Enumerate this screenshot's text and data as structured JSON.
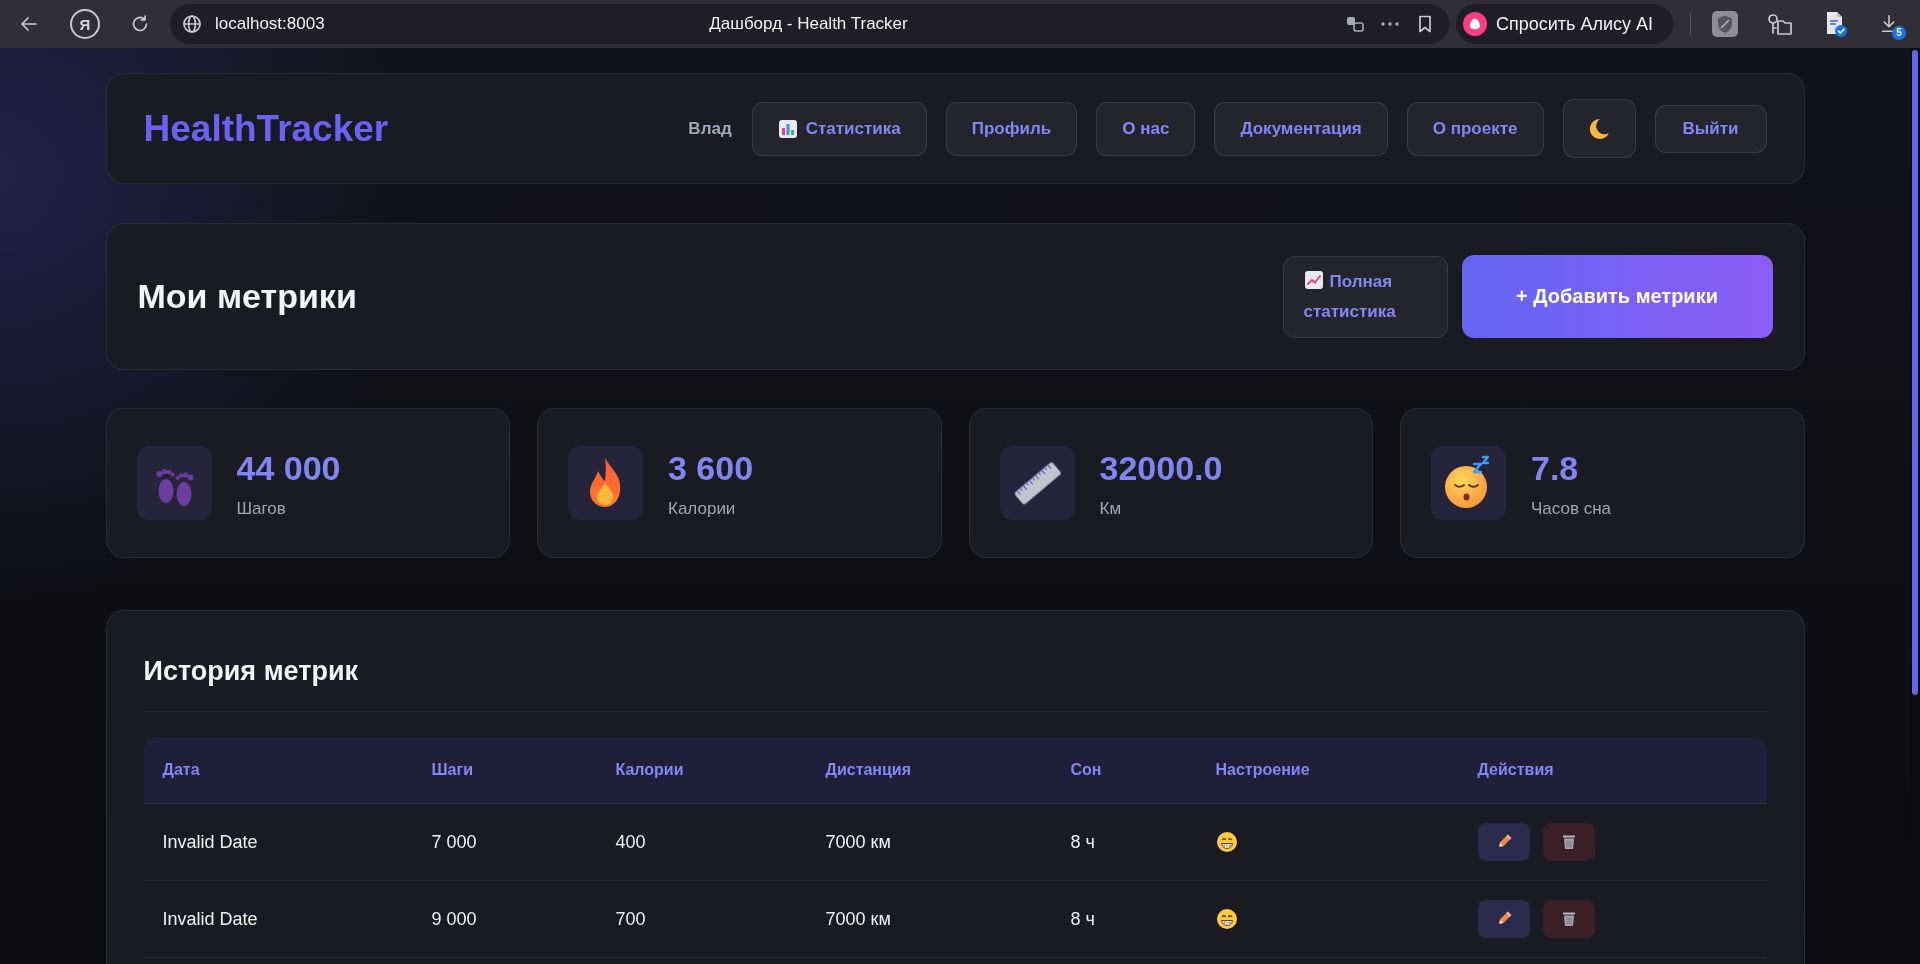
{
  "browser": {
    "home_button": "Я",
    "address": "localhost:8003",
    "page_title": "Дашборд - Health Tracker",
    "assistant_button": "Спросить Алису AI",
    "downloads_badge": "5"
  },
  "header": {
    "logo": "HealthTracker",
    "user_name": "Влад",
    "nav": [
      {
        "label": "Статистика",
        "kind": "icon"
      },
      {
        "label": "Профиль",
        "kind": "text"
      },
      {
        "label": "О нас",
        "kind": "text"
      },
      {
        "label": "Документация",
        "kind": "text"
      },
      {
        "label": "О проекте",
        "kind": "text"
      }
    ],
    "dark_mode": true,
    "logout_button": "Выйти"
  },
  "metrics_panel": {
    "title": "Мои метрики",
    "stats_button": "Полная статистика",
    "add_button": "+ Добавить метрики"
  },
  "summary_cards": [
    {
      "kind": "steps",
      "value": "44 000",
      "label": "Шагов"
    },
    {
      "kind": "calories",
      "value": "3 600",
      "label": "Калории"
    },
    {
      "kind": "distance",
      "value": "32000.0",
      "label": "Км"
    },
    {
      "kind": "sleep",
      "value": "7.8",
      "label": "Часов сна"
    }
  ],
  "history": {
    "title": "История метрик",
    "columns": [
      "Дата",
      "Шаги",
      "Калории",
      "Дистанция",
      "Сон",
      "Настроение",
      "Действия"
    ],
    "rows": [
      {
        "date": "Invalid Date",
        "steps": "7 000",
        "calories": "400",
        "distance": "7000 км",
        "sleep": "8 ч"
      },
      {
        "date": "Invalid Date",
        "steps": "9 000",
        "calories": "700",
        "distance": "7000 км",
        "sleep": "8 ч"
      }
    ]
  }
}
